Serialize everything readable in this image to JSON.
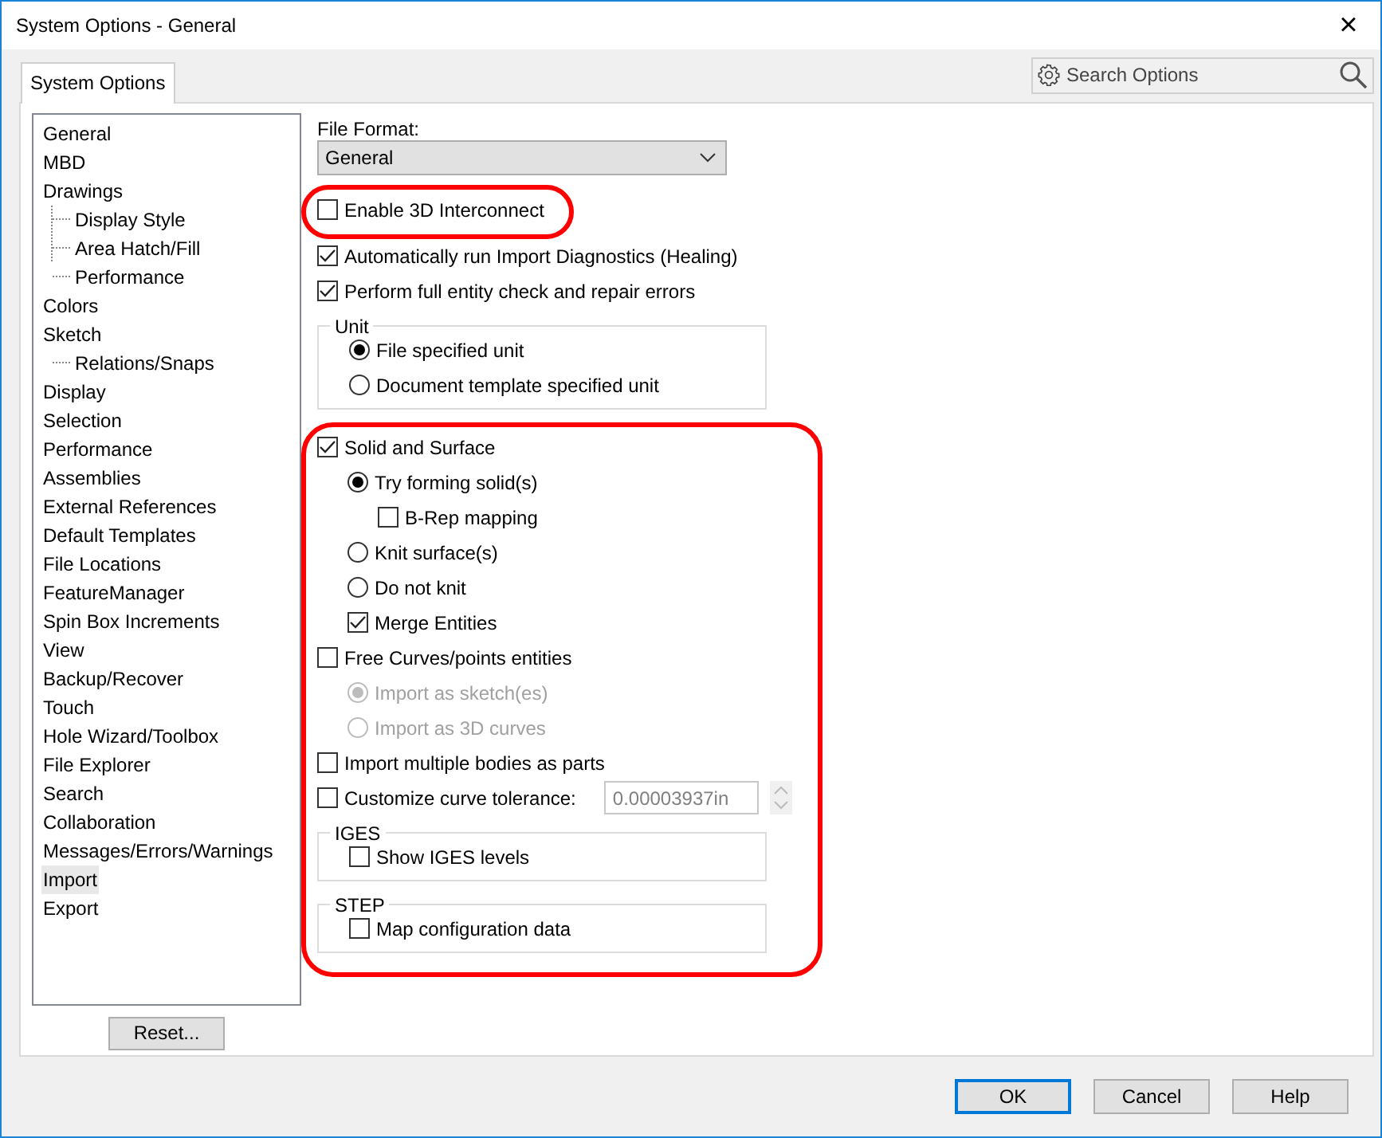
{
  "window": {
    "title": "System Options - General",
    "close": "×"
  },
  "tabs": [
    {
      "label": "System Options",
      "selected": true
    }
  ],
  "search": {
    "placeholder": "Search Options"
  },
  "tree": [
    {
      "label": "General",
      "selected": false
    },
    {
      "label": "MBD",
      "selected": false
    },
    {
      "label": "Drawings",
      "selected": false,
      "children": [
        {
          "label": "Display Style",
          "selected": false
        },
        {
          "label": "Area Hatch/Fill",
          "selected": false
        },
        {
          "label": "Performance",
          "selected": false
        }
      ]
    },
    {
      "label": "Colors",
      "selected": false
    },
    {
      "label": "Sketch",
      "selected": false,
      "children": [
        {
          "label": "Relations/Snaps",
          "selected": false
        }
      ]
    },
    {
      "label": "Display",
      "selected": false
    },
    {
      "label": "Selection",
      "selected": false
    },
    {
      "label": "Performance",
      "selected": false
    },
    {
      "label": "Assemblies",
      "selected": false
    },
    {
      "label": "External References",
      "selected": false
    },
    {
      "label": "Default Templates",
      "selected": false
    },
    {
      "label": "File Locations",
      "selected": false
    },
    {
      "label": "FeatureManager",
      "selected": false
    },
    {
      "label": "Spin Box Increments",
      "selected": false
    },
    {
      "label": "View",
      "selected": false
    },
    {
      "label": "Backup/Recover",
      "selected": false
    },
    {
      "label": "Touch",
      "selected": false
    },
    {
      "label": "Hole Wizard/Toolbox",
      "selected": false
    },
    {
      "label": "File Explorer",
      "selected": false
    },
    {
      "label": "Search",
      "selected": false
    },
    {
      "label": "Collaboration",
      "selected": false
    },
    {
      "label": "Messages/Errors/Warnings",
      "selected": false
    },
    {
      "label": "Import",
      "selected": true
    },
    {
      "label": "Export",
      "selected": false
    }
  ],
  "reset_button": "Reset...",
  "file_format": {
    "label": "File Format:",
    "value": "General"
  },
  "sections": [
    {
      "highlighted": true,
      "items": [
        {
          "kind": "checkbox",
          "label": "Enable 3D Interconnect",
          "checked": false
        }
      ]
    },
    {
      "highlighted": false,
      "items": [
        {
          "kind": "checkbox",
          "label": "Automatically run Import Diagnostics (Healing)",
          "checked": true
        },
        {
          "kind": "checkbox",
          "label": "Perform full entity check and repair errors",
          "checked": true
        },
        {
          "kind": "group",
          "title": "Unit",
          "children": [
            {
              "kind": "radio",
              "label": "File specified unit",
              "selected": true,
              "disabled": false
            },
            {
              "kind": "radio",
              "label": "Document template specified unit",
              "selected": false,
              "disabled": false
            }
          ]
        }
      ]
    },
    {
      "highlighted": true,
      "items": [
        {
          "kind": "checkbox",
          "label": "Solid and Surface",
          "checked": true,
          "children": [
            {
              "kind": "radio",
              "label": "Try forming solid(s)",
              "selected": true,
              "disabled": false,
              "children": [
                {
                  "kind": "checkbox",
                  "label": "B-Rep mapping",
                  "checked": false
                }
              ]
            },
            {
              "kind": "radio",
              "label": "Knit surface(s)",
              "selected": false,
              "disabled": false
            },
            {
              "kind": "radio",
              "label": "Do not knit",
              "selected": false,
              "disabled": false
            },
            {
              "kind": "checkbox",
              "label": "Merge Entities",
              "checked": true
            }
          ]
        },
        {
          "kind": "checkbox",
          "label": "Free Curves/points entities",
          "checked": false,
          "children": [
            {
              "kind": "radio",
              "label": "Import as sketch(es)",
              "selected": true,
              "disabled": true
            },
            {
              "kind": "radio",
              "label": "Import as 3D curves",
              "selected": false,
              "disabled": true
            }
          ]
        },
        {
          "kind": "checkbox",
          "label": "Import multiple bodies as parts",
          "checked": false
        },
        {
          "kind": "checkbox",
          "label": "Customize curve tolerance:",
          "checked": false,
          "field": {
            "value": "0.00003937in",
            "disabled": true
          }
        },
        {
          "kind": "group",
          "title": "IGES",
          "children": [
            {
              "kind": "checkbox",
              "label": "Show IGES levels",
              "checked": false
            }
          ]
        },
        {
          "kind": "group",
          "title": "STEP",
          "children": [
            {
              "kind": "checkbox",
              "label": "Map configuration data",
              "checked": false
            }
          ]
        }
      ]
    }
  ],
  "buttons": [
    {
      "label": "OK",
      "default": true
    },
    {
      "label": "Cancel",
      "default": false
    },
    {
      "label": "Help",
      "default": false
    }
  ]
}
